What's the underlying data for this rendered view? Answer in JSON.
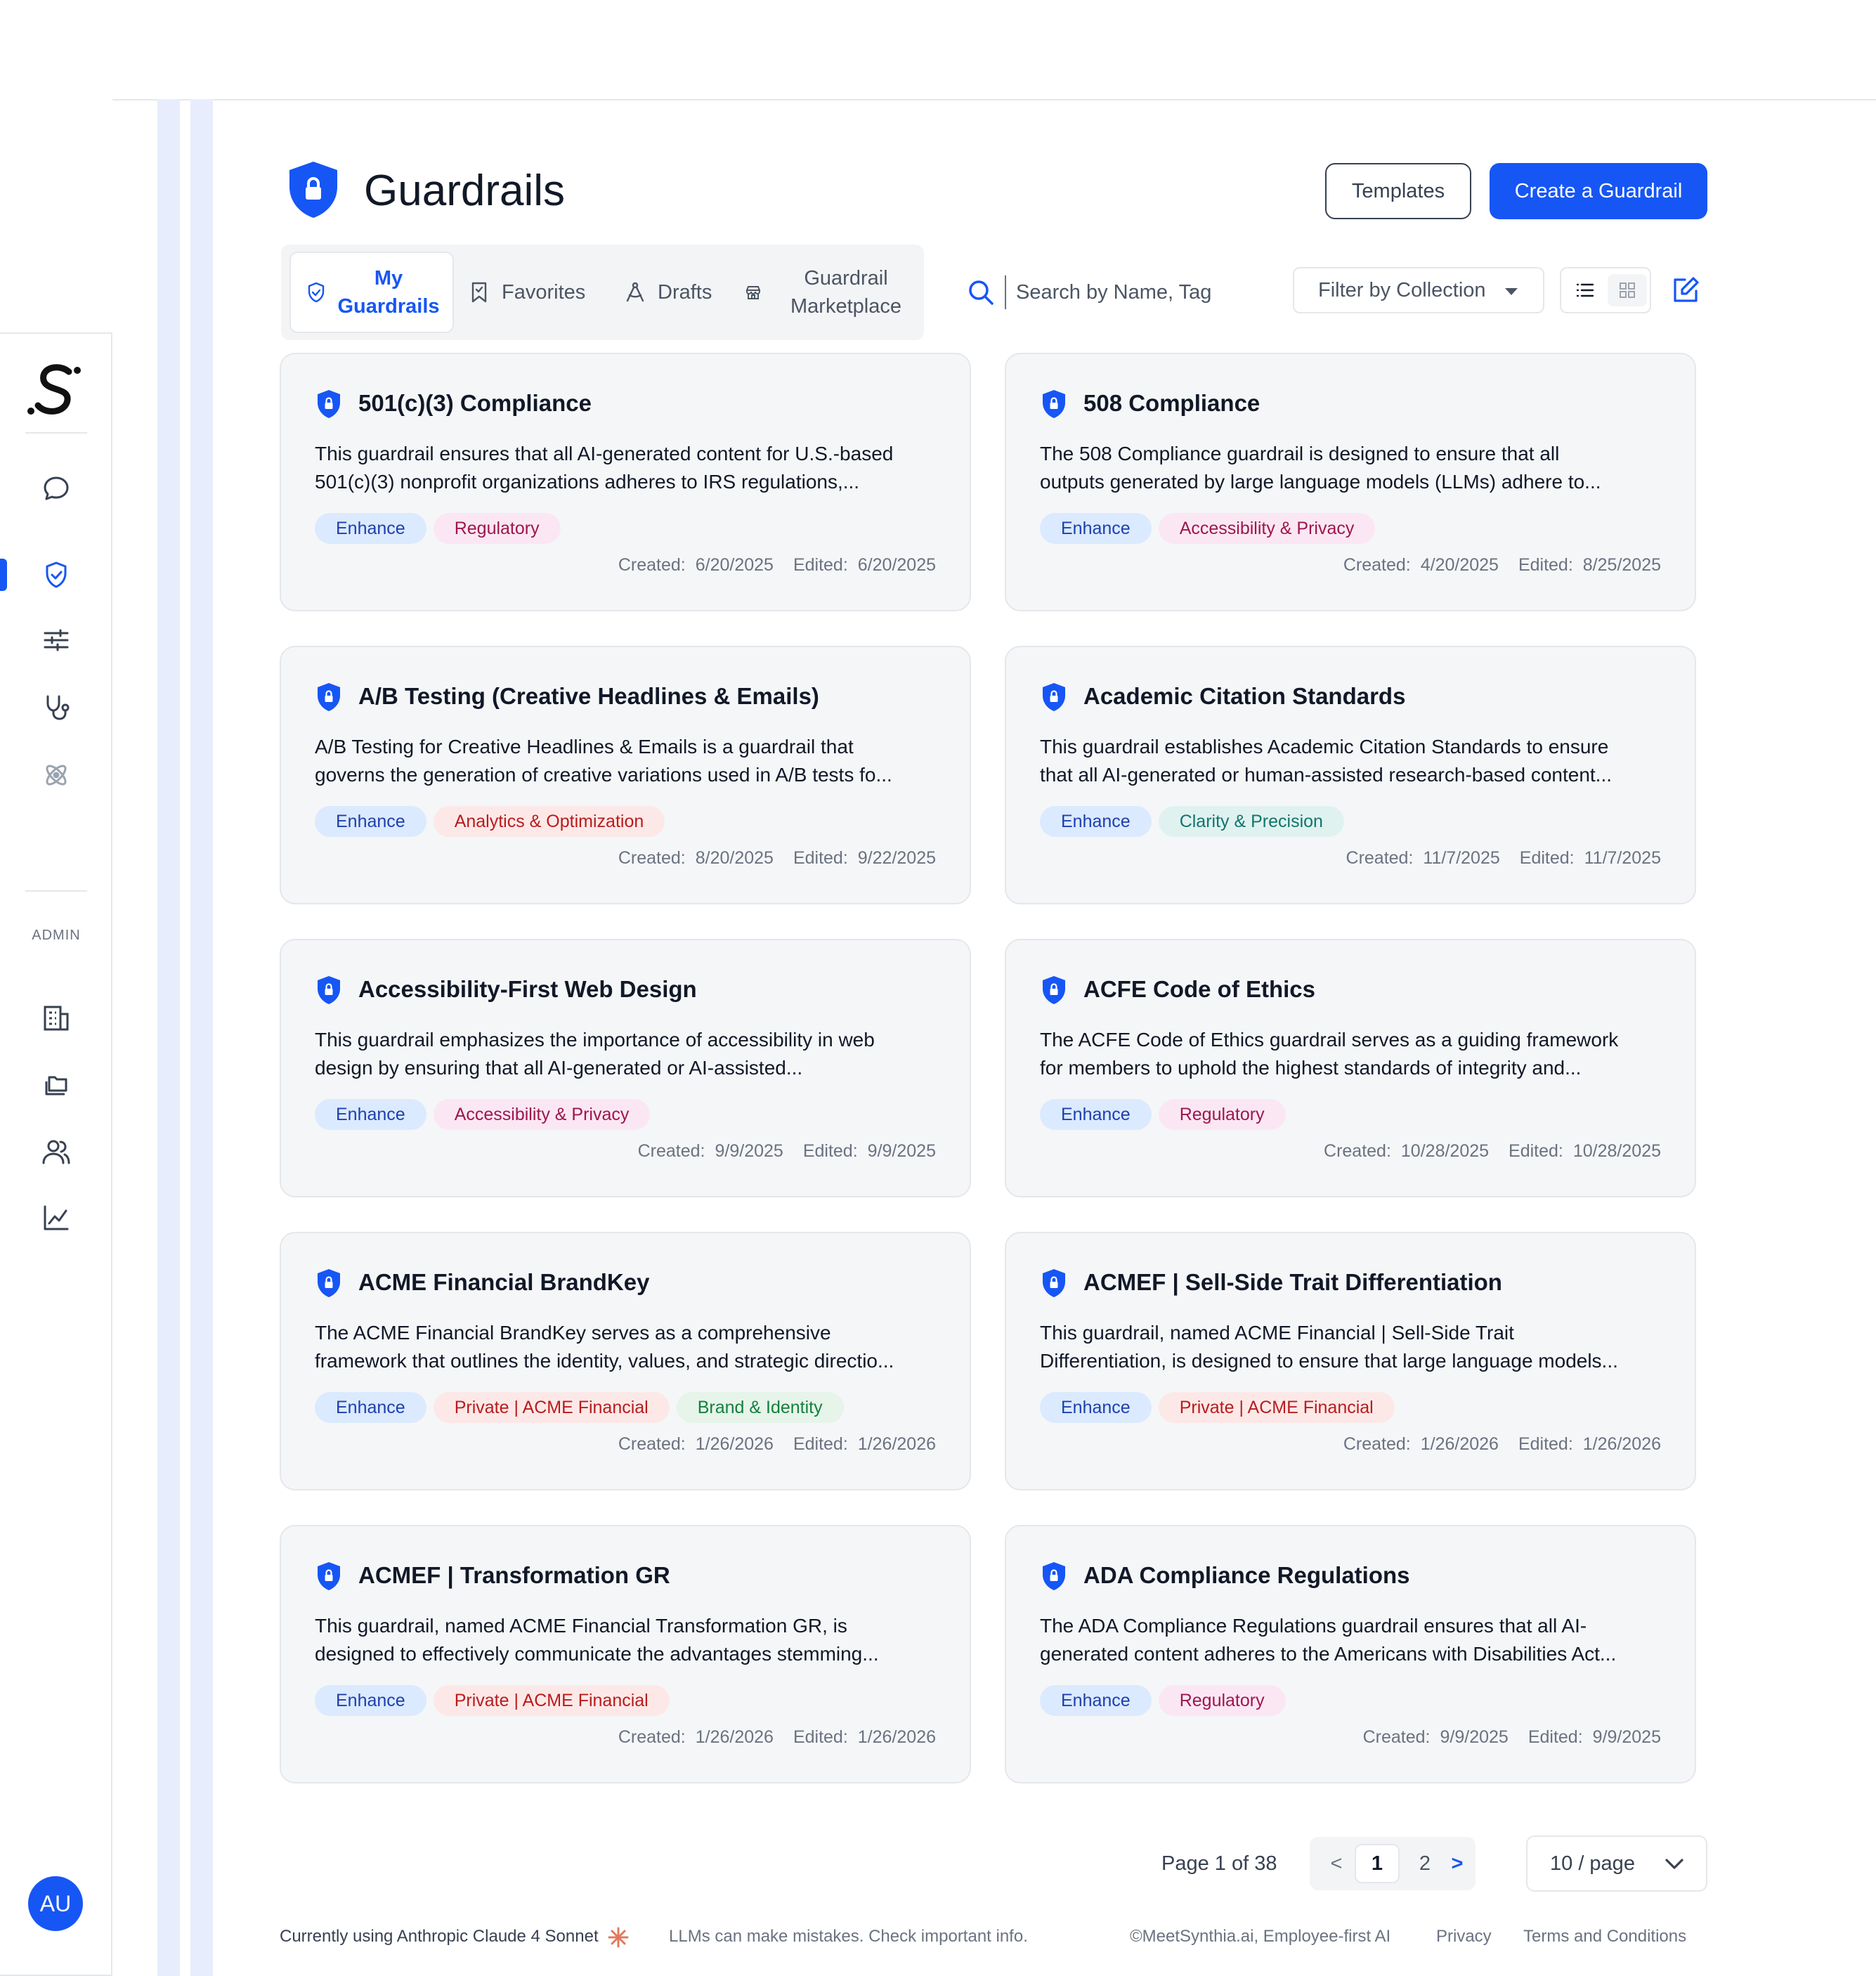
{
  "header": {
    "title": "Guardrails",
    "templates_label": "Templates",
    "create_label": "Create a Guardrail"
  },
  "tabs": [
    {
      "label": "My Guardrails",
      "icon": "shield-check-icon",
      "active": true
    },
    {
      "label": "Favorites",
      "icon": "bookmark-icon",
      "active": false
    },
    {
      "label": "Drafts",
      "icon": "compass-icon",
      "active": false
    },
    {
      "label": "Guardrail Marketplace",
      "icon": "store-icon",
      "active": false
    }
  ],
  "search": {
    "placeholder": "Search by Name, Tag"
  },
  "filter": {
    "label": "Filter by Collection"
  },
  "sidebar": {
    "admin_label": "ADMIN",
    "avatar_initials": "AU",
    "items": [
      "chat-icon",
      "shield-check-icon",
      "sliders-icon",
      "stethoscope-icon",
      "atom-icon",
      "building-icon",
      "folders-icon",
      "users-icon",
      "chart-icon"
    ]
  },
  "colors": {
    "accent": "#1656f5",
    "tag_enhance_bg": "#dbeafe",
    "tag_enhance_fg": "#1e40af",
    "tag_regulatory_bg": "#fbe7f3",
    "tag_regulatory_fg": "#9d174d",
    "tag_analytics_bg": "#fde8e8",
    "tag_analytics_fg": "#b91c1c",
    "tag_clarity_bg": "#e0f2ef",
    "tag_clarity_fg": "#0f766e",
    "tag_brand_bg": "#e6f4ea",
    "tag_brand_fg": "#15803d"
  },
  "labels": {
    "created": "Created:",
    "edited": "Edited:"
  },
  "cards": [
    {
      "title": "501(c)(3) Compliance",
      "desc_line1": "This guardrail ensures that all AI-generated content for U.S.-based",
      "desc_line2": "501(c)(3) nonprofit organizations adheres to IRS regulations,...",
      "tags": [
        "Enhance",
        "Regulatory"
      ],
      "created": "6/20/2025",
      "edited": "6/20/2025"
    },
    {
      "title": "508 Compliance",
      "desc_line1": "The 508 Compliance guardrail is designed to ensure that all",
      "desc_line2": "outputs generated by large language models (LLMs) adhere to...",
      "tags": [
        "Enhance",
        "Accessibility & Privacy"
      ],
      "created": "4/20/2025",
      "edited": "8/25/2025"
    },
    {
      "title": "A/B Testing (Creative Headlines & Emails)",
      "desc_line1": "A/B Testing for Creative Headlines & Emails is a guardrail that",
      "desc_line2": "governs the generation of creative variations used in A/B tests fo...",
      "tags": [
        "Enhance",
        "Analytics & Optimization"
      ],
      "created": "8/20/2025",
      "edited": "9/22/2025"
    },
    {
      "title": "Academic Citation Standards",
      "desc_line1": "This guardrail establishes Academic Citation Standards to ensure",
      "desc_line2": "that all AI-generated or human-assisted research-based content...",
      "tags": [
        "Enhance",
        "Clarity & Precision"
      ],
      "created": "11/7/2025",
      "edited": "11/7/2025"
    },
    {
      "title": "Accessibility-First Web Design",
      "desc_line1": "This guardrail emphasizes the importance of accessibility in web",
      "desc_line2": "design by ensuring that all AI-generated or AI-assisted...",
      "tags": [
        "Enhance",
        "Accessibility & Privacy"
      ],
      "created": "9/9/2025",
      "edited": "9/9/2025"
    },
    {
      "title": "ACFE Code of Ethics",
      "desc_line1": "The ACFE Code of Ethics guardrail serves as a guiding framework",
      "desc_line2": "for members to uphold the highest standards of integrity and...",
      "tags": [
        "Enhance",
        "Regulatory"
      ],
      "created": "10/28/2025",
      "edited": "10/28/2025"
    },
    {
      "title": "ACME Financial BrandKey",
      "desc_line1": "The ACME Financial BrandKey serves as a comprehensive",
      "desc_line2": "framework that outlines the identity, values, and strategic directio...",
      "tags": [
        "Enhance",
        "Private | ACME Financial",
        "Brand & Identity"
      ],
      "created": "1/26/2026",
      "edited": "1/26/2026"
    },
    {
      "title": "ACMEF | Sell-Side Trait Differentiation",
      "desc_line1": "This guardrail, named ACME Financial | Sell-Side Trait",
      "desc_line2": "Differentiation, is designed to ensure that large language models...",
      "tags": [
        "Enhance",
        "Private | ACME Financial"
      ],
      "created": "1/26/2026",
      "edited": "1/26/2026"
    },
    {
      "title": "ACMEF | Transformation GR",
      "desc_line1": "This guardrail, named ACME Financial Transformation GR, is",
      "desc_line2": "designed to effectively communicate the advantages stemming...",
      "tags": [
        "Enhance",
        "Private | ACME Financial"
      ],
      "created": "1/26/2026",
      "edited": "1/26/2026"
    },
    {
      "title": "ADA Compliance Regulations",
      "desc_line1": "The ADA Compliance Regulations guardrail ensures that all AI-",
      "desc_line2": "generated content adheres to the Americans with Disabilities Act...",
      "tags": [
        "Enhance",
        "Regulatory"
      ],
      "created": "9/9/2025",
      "edited": "9/9/2025"
    }
  ],
  "pagination": {
    "info": "Page 1 of 38",
    "prev": "<",
    "next": ">",
    "pages": [
      "1",
      "2"
    ],
    "current": "1",
    "per_page": "10 / page"
  },
  "footer": {
    "model": "Currently using Anthropic Claude 4 Sonnet",
    "warning": "LLMs can make mistakes. Check important info.",
    "copyright": "©MeetSynthia.ai, Employee-first AI",
    "privacy": "Privacy",
    "terms": "Terms and Conditions"
  }
}
